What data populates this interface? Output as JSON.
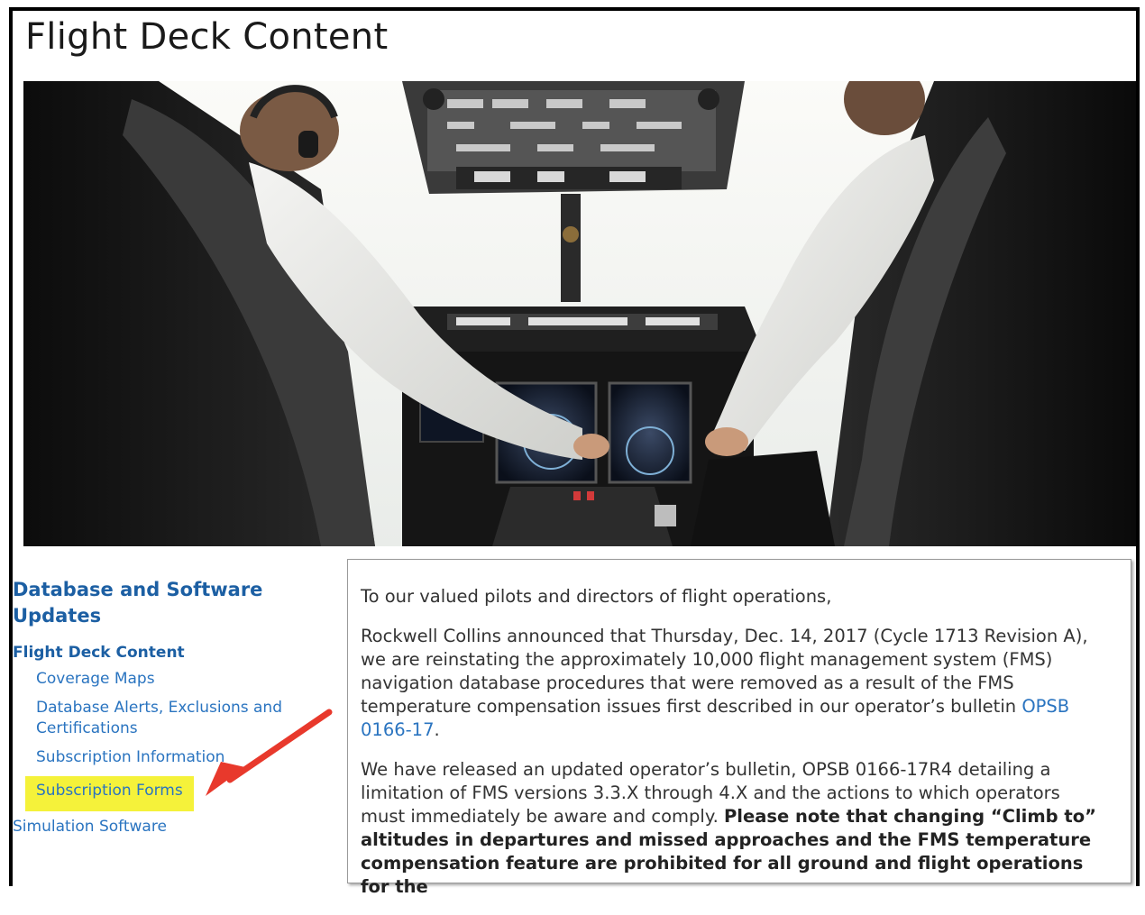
{
  "page": {
    "title": "Flight Deck Content"
  },
  "sidebar": {
    "heading": "Database and Software Updates",
    "section_title": "Flight Deck Content",
    "items": [
      {
        "label": "Coverage Maps"
      },
      {
        "label": "Database Alerts, Exclusions and Certifications"
      },
      {
        "label": "Subscription Information"
      },
      {
        "label": "Subscription Forms"
      }
    ],
    "bottom_item": "Simulation Software"
  },
  "content": {
    "greeting": "To our valued pilots and directors of flight operations,",
    "para1_text": "Rockwell Collins announced that Thursday, Dec. 14, 2017 (Cycle 1713 Revision A), we are reinstating the approximately 10,000 flight management system (FMS) navigation database procedures that were removed as a result of the FMS temperature compensation issues first described in our operator’s bulletin ",
    "para1_link": "OPSB 0166-17",
    "para1_end": ".",
    "para2_text": "We have released an updated operator’s bulletin, OPSB 0166-17R4 detailing a limitation of FMS versions 3.3.X through 4.X and the actions to which operators must immediately be aware and comply. ",
    "para2_bold": "Please note that changing “Climb to” altitudes in departures and missed approaches and the FMS temperature compensation feature are prohibited for all ground and flight operations for the"
  },
  "colors": {
    "heading_blue": "#1c5fa3",
    "link_blue": "#2a74c0",
    "highlight": "#f5f23a",
    "arrow": "#e8392c"
  }
}
